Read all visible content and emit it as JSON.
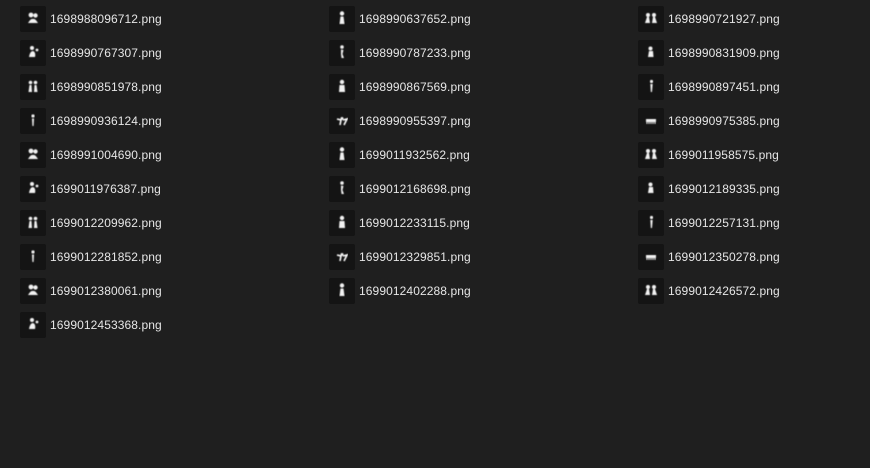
{
  "files": [
    {
      "name": "1698988096712.png",
      "icon": "group-silhouette-thumbnail"
    },
    {
      "name": "1698990637652.png",
      "icon": "person-silhouette-thumbnail"
    },
    {
      "name": "1698990721927.png",
      "icon": "group-silhouette-thumbnail"
    },
    {
      "name": "1698990767307.png",
      "icon": "group-silhouette-thumbnail"
    },
    {
      "name": "1698990787233.png",
      "icon": "person-silhouette-thumbnail"
    },
    {
      "name": "1698990831909.png",
      "icon": "person-silhouette-thumbnail"
    },
    {
      "name": "1698990851978.png",
      "icon": "group-silhouette-thumbnail"
    },
    {
      "name": "1698990867569.png",
      "icon": "person-silhouette-thumbnail"
    },
    {
      "name": "1698990897451.png",
      "icon": "person-silhouette-thumbnail"
    },
    {
      "name": "1698990936124.png",
      "icon": "person-silhouette-thumbnail"
    },
    {
      "name": "1698990955397.png",
      "icon": "group-silhouette-thumbnail"
    },
    {
      "name": "1698990975385.png",
      "icon": "group-silhouette-thumbnail"
    },
    {
      "name": "1698991004690.png",
      "icon": "group-silhouette-thumbnail"
    },
    {
      "name": "1699011932562.png",
      "icon": "group-silhouette-thumbnail"
    },
    {
      "name": "1699011958575.png",
      "icon": "group-silhouette-thumbnail"
    },
    {
      "name": "1699011976387.png",
      "icon": "person-silhouette-thumbnail"
    },
    {
      "name": "1699012168698.png",
      "icon": "group-silhouette-thumbnail"
    },
    {
      "name": "1699012189335.png",
      "icon": "person-silhouette-thumbnail"
    },
    {
      "name": "1699012209962.png",
      "icon": "person-silhouette-thumbnail"
    },
    {
      "name": "1699012233115.png",
      "icon": "group-silhouette-thumbnail"
    },
    {
      "name": "1699012257131.png",
      "icon": "group-silhouette-thumbnail"
    },
    {
      "name": "1699012281852.png",
      "icon": "group-silhouette-thumbnail"
    },
    {
      "name": "1699012329851.png",
      "icon": "group-silhouette-thumbnail"
    },
    {
      "name": "1699012350278.png",
      "icon": "group-silhouette-thumbnail"
    },
    {
      "name": "1699012380061.png",
      "icon": "person-silhouette-thumbnail"
    },
    {
      "name": "1699012402288.png",
      "icon": "person-silhouette-thumbnail"
    },
    {
      "name": "1699012426572.png",
      "icon": "group-silhouette-thumbnail"
    },
    {
      "name": "1699012453368.png",
      "icon": "person-silhouette-thumbnail"
    }
  ],
  "colors": {
    "background": "#1f1f1f",
    "thumbnail_background": "#141414",
    "text": "#e6e6e6"
  }
}
